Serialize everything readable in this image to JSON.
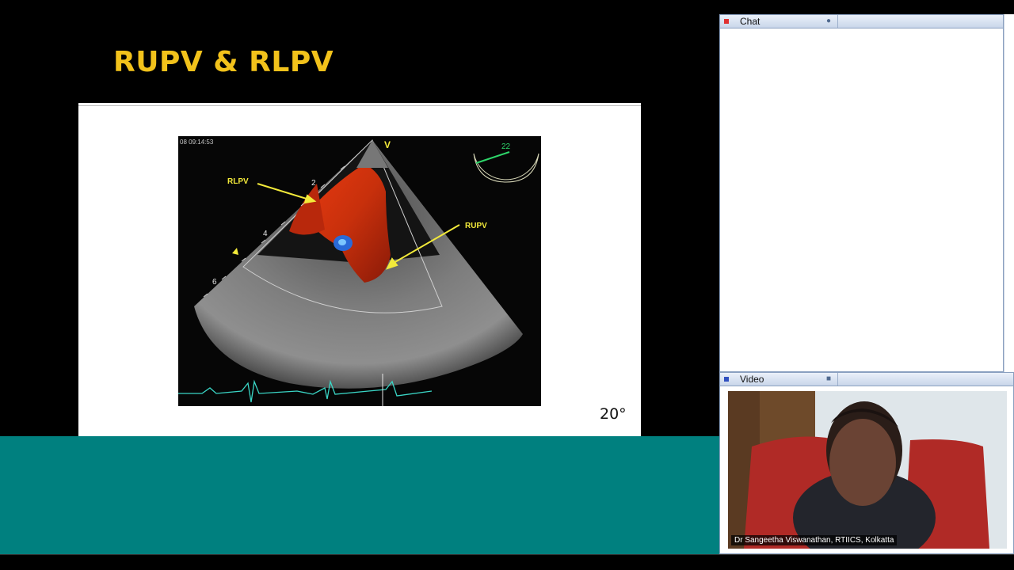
{
  "slide": {
    "title": "RUPV & RLPV",
    "image": {
      "timestamp": "08 09:14:53",
      "orientation_marker": "V",
      "angle_readout": "22",
      "labels": {
        "left_vein": "RLPV",
        "right_vein": "RUPV"
      },
      "depth_marks": [
        "2",
        "4",
        "6"
      ]
    },
    "angle_label": "20°"
  },
  "chat": {
    "title": "Chat",
    "icon": "chat-bubble-icon",
    "dot_color": "#e03030"
  },
  "video": {
    "title": "Video",
    "icon": "camera-icon",
    "dot_color": "#3050c0",
    "caption": "Dr Sangeetha Viswanathan, RTIICS, Kolkatta"
  },
  "colors": {
    "title_gold": "#f2c21b",
    "teal": "#00807f",
    "annotation_yellow": "#f3ea3a"
  }
}
